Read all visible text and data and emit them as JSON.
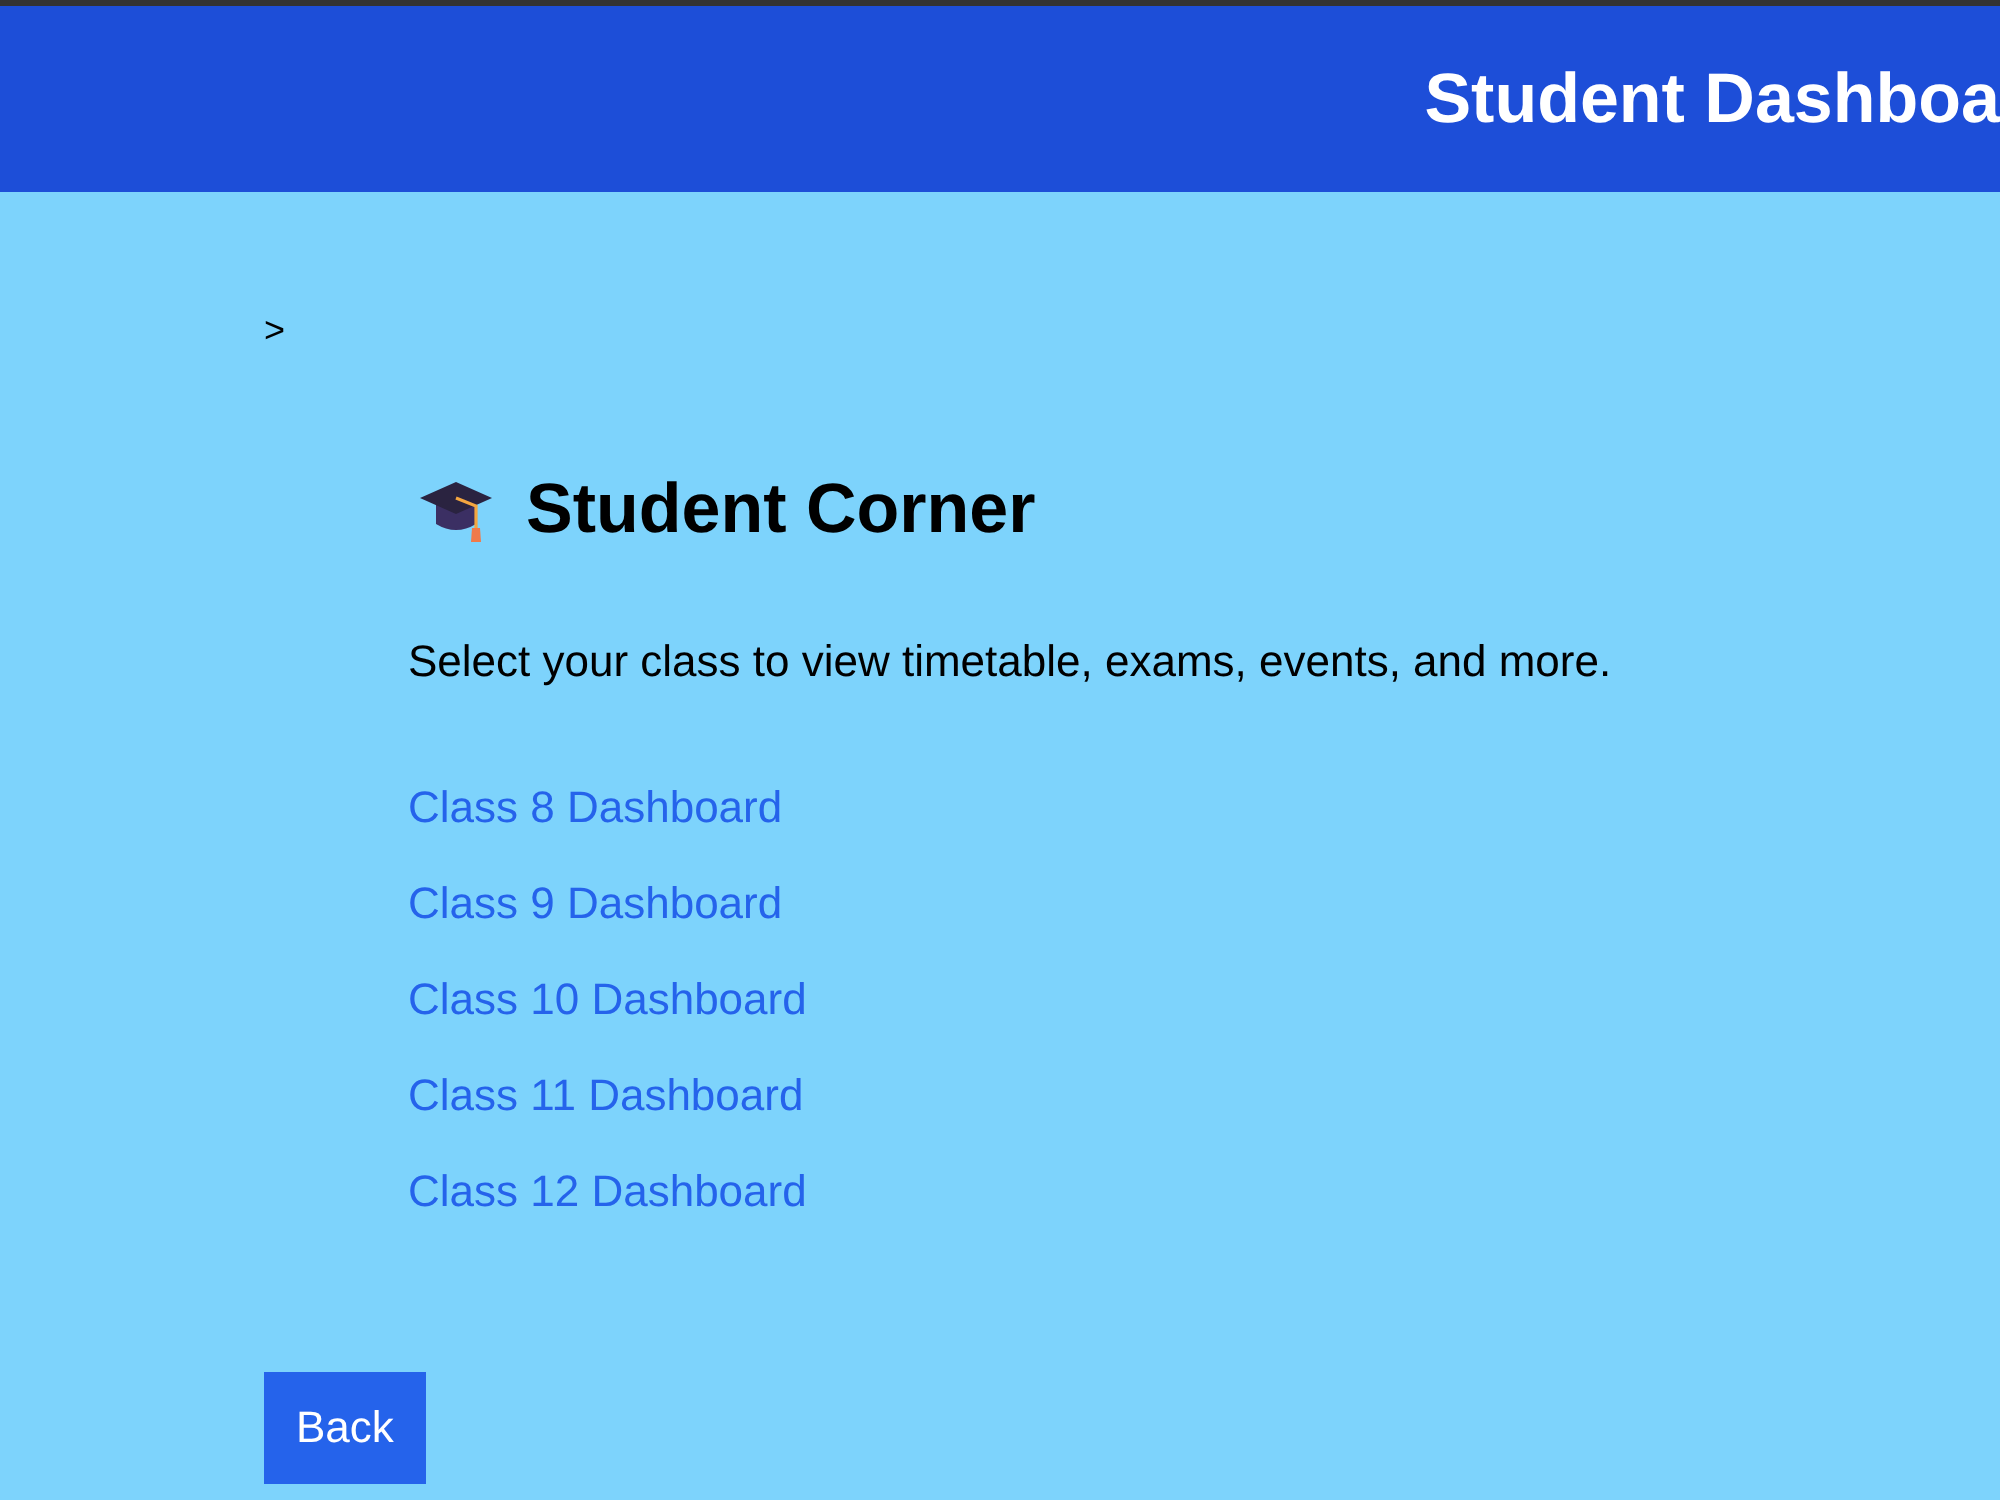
{
  "header": {
    "title": "Student Dashboa"
  },
  "breadcrumb": {
    "separator": ">"
  },
  "section": {
    "title": "Student Corner",
    "description": "Select your class to view timetable, exams, events, and more.",
    "links": [
      "Class 8 Dashboard",
      "Class 9 Dashboard",
      "Class 10 Dashboard",
      "Class 11 Dashboard",
      "Class 12 Dashboard"
    ]
  },
  "back_button": {
    "label": "Back"
  }
}
